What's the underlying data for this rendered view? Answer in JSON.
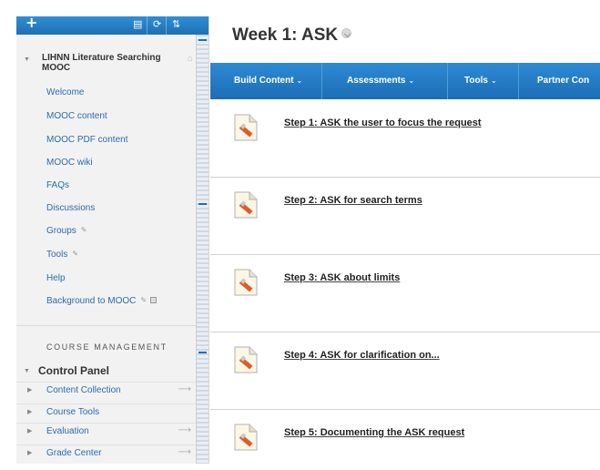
{
  "sidebar": {
    "toolbar": {
      "add_icon": "plus-icon",
      "icons": [
        "menu-icon",
        "refresh-icon",
        "sort-icon"
      ]
    },
    "course": {
      "title": "LIHNN Literature Searching MOOC",
      "home_icon": "home-icon"
    },
    "nav_items": [
      {
        "label": "Welcome"
      },
      {
        "label": "MOOC content"
      },
      {
        "label": "MOOC PDF content"
      },
      {
        "label": "MOOC wiki"
      },
      {
        "label": "FAQs"
      },
      {
        "label": "Discussions"
      },
      {
        "label": "Groups",
        "hidden_icon": true
      },
      {
        "label": "Tools",
        "hidden_icon": true
      },
      {
        "label": "Help"
      },
      {
        "label": "Background to MOOC",
        "hidden_icon": true,
        "square_icon": true
      }
    ],
    "course_management": {
      "heading": "COURSE MANAGEMENT",
      "control_panel": "Control Panel",
      "items": [
        {
          "label": "Content Collection",
          "has_go": true
        },
        {
          "label": "Course Tools",
          "has_go": false
        },
        {
          "label": "Evaluation",
          "has_go": true
        },
        {
          "label": "Grade Center",
          "has_go": true
        }
      ]
    }
  },
  "main": {
    "title": "Week 1: ASK",
    "action_bar": [
      {
        "label": "Build Content"
      },
      {
        "label": "Assessments"
      },
      {
        "label": "Tools"
      },
      {
        "label": "Partner Con"
      }
    ],
    "items": [
      {
        "title": "Step 1: ASK the user to focus the request",
        "icon": "document-icon"
      },
      {
        "title": "Step 2: ASK for search terms",
        "icon": "document-icon"
      },
      {
        "title": "Step 3: ASK about limits",
        "icon": "document-icon"
      },
      {
        "title": "Step 4: ASK for clarification on...",
        "icon": "document-icon"
      },
      {
        "title": "Step 5: Documenting the ASK request",
        "icon": "document-icon"
      }
    ]
  },
  "colors": {
    "accent_blue": "#1e6fb3",
    "link_blue": "#2a6bb0",
    "sidebar_bg": "#f2f2f2"
  }
}
